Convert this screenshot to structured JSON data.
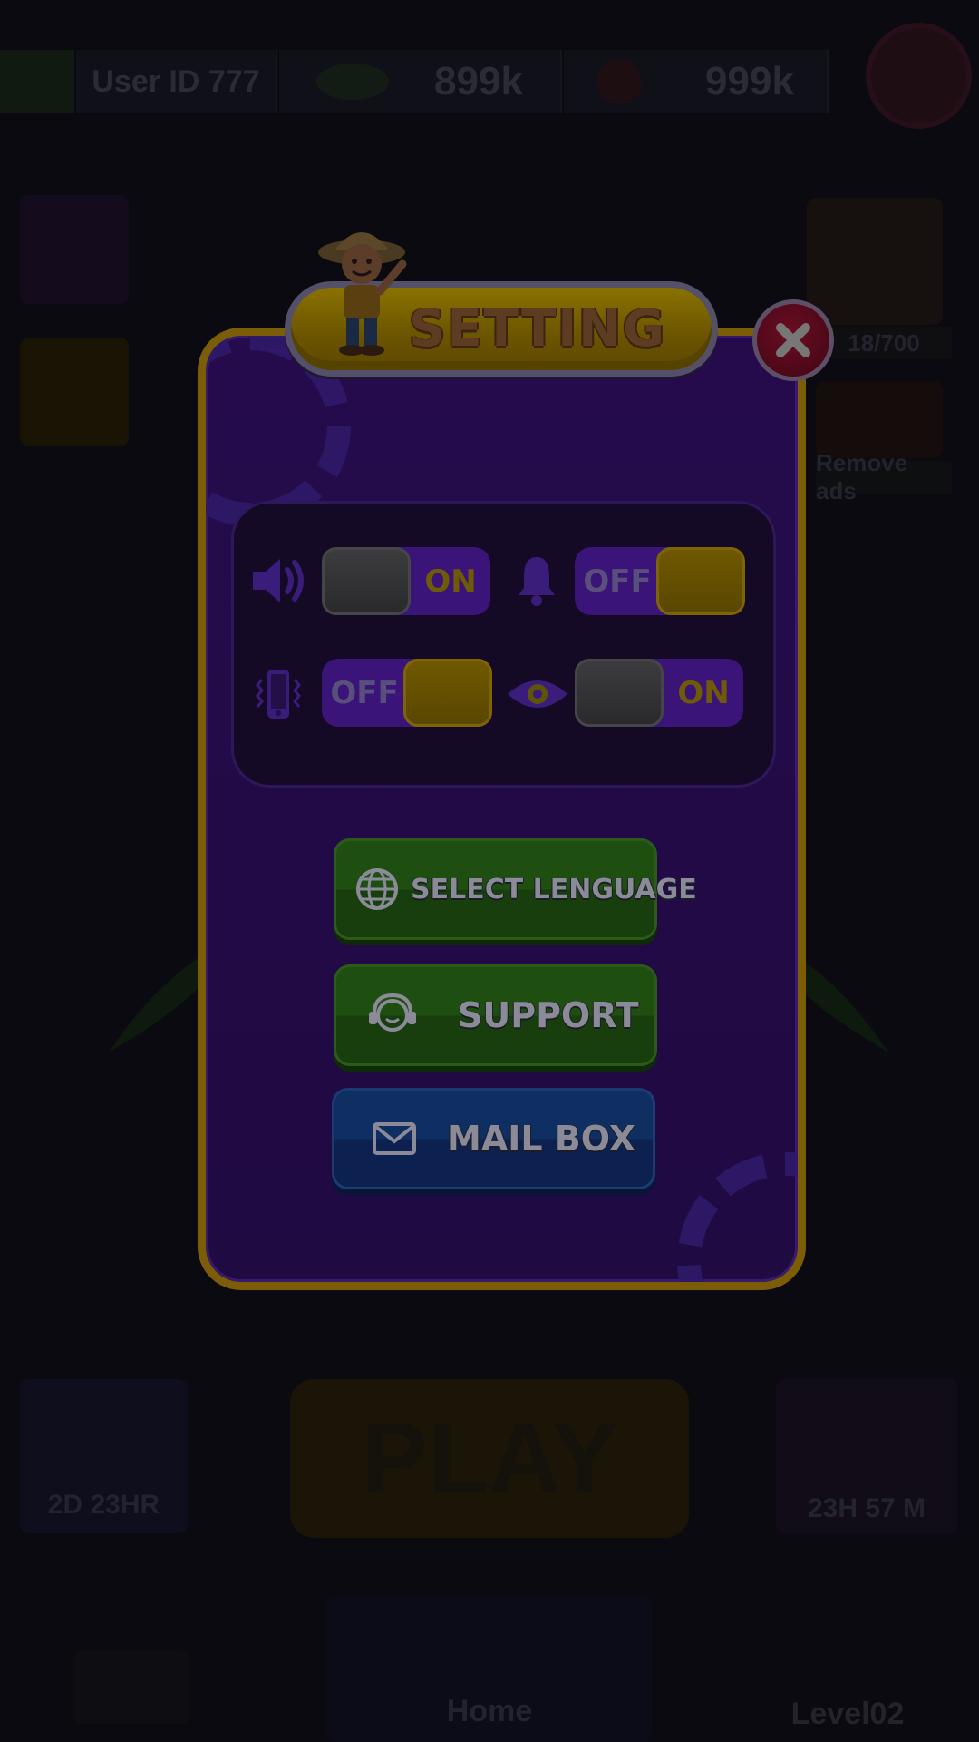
{
  "background": {
    "user_id_label": "User ID 777",
    "coins": "899k",
    "gems": "999k",
    "progress": "18/700",
    "remove_ads": "Remove ads",
    "timer_left": "2D 23HR",
    "play_label": "PLAY",
    "timer_right": "23H 57 M",
    "nav_home": "Home",
    "nav_level": "Level02"
  },
  "dialog": {
    "title": "SETTING",
    "toggles": [
      {
        "icon": "speaker-icon",
        "state": "ON"
      },
      {
        "icon": "bell-icon",
        "state": "OFF"
      },
      {
        "icon": "vibration-icon",
        "state": "OFF"
      },
      {
        "icon": "eye-icon",
        "state": "ON"
      }
    ],
    "buttons": {
      "language": {
        "label": "SELECT LENGUAGE",
        "icon": "globe-icon"
      },
      "support": {
        "label": "SUPPORT",
        "icon": "headset-icon"
      },
      "mailbox": {
        "label": "MAIL BOX",
        "icon": "mail-icon"
      }
    },
    "close_icon": "close-icon"
  },
  "colors": {
    "panel": "#250b4c",
    "frame_gold": "#7a5d06",
    "toggle_track": "#3a1478",
    "green_button": "#1f4e11",
    "blue_button": "#0f2e62",
    "close_red": "#4d0818"
  }
}
